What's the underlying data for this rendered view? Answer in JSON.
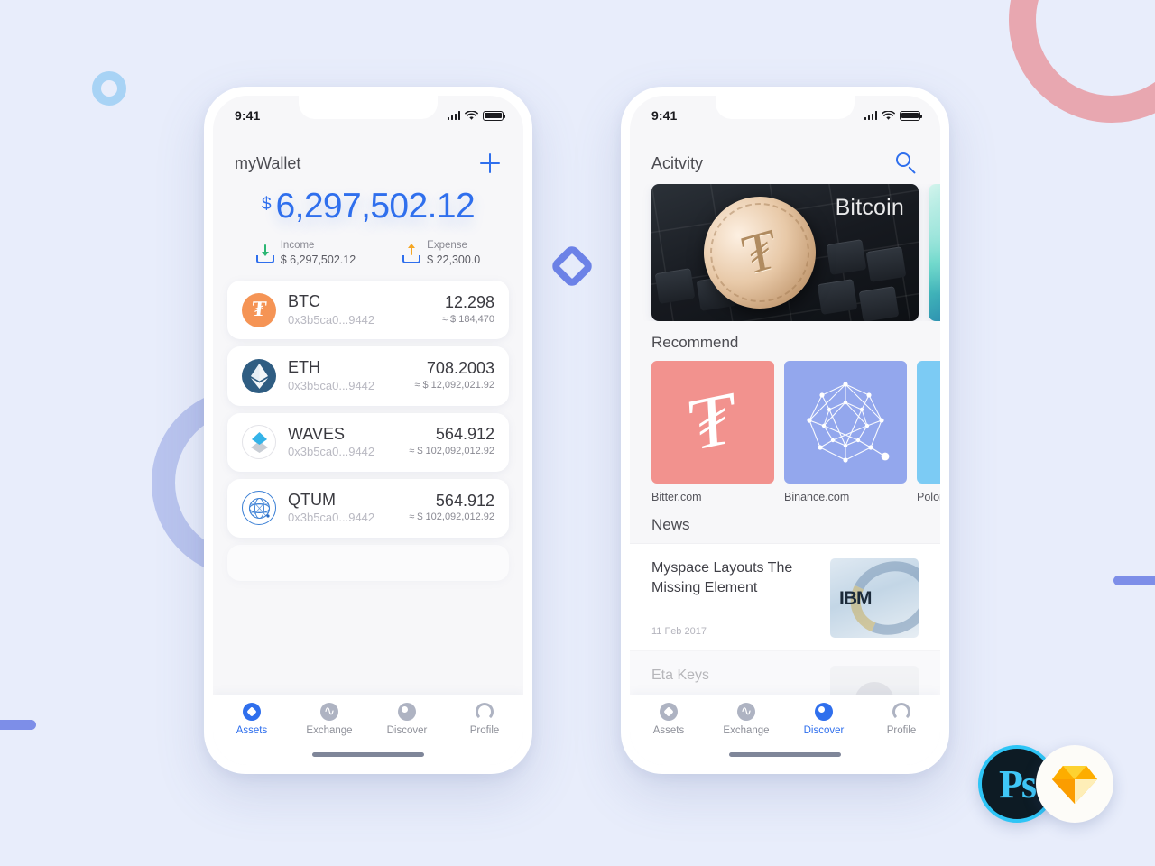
{
  "background": {
    "color": "#e8edfb",
    "decorations": [
      {
        "name": "ring-pink",
        "color": "#e8a7b0"
      },
      {
        "name": "ring-periwinkle",
        "color": "#b9c4ee"
      },
      {
        "name": "ring-lightblue",
        "color": "#a8d3f5"
      },
      {
        "name": "diamond-outline",
        "color": "#6d83e8"
      },
      {
        "name": "bar-left",
        "color": "#7d8ee8"
      },
      {
        "name": "bar-right",
        "color": "#7d8ee8"
      }
    ]
  },
  "accent_color": "#2f6fed",
  "wallet_screen": {
    "statusbar": {
      "time": "9:41",
      "icons": [
        "signal-icon",
        "wifi-icon",
        "battery-icon"
      ]
    },
    "header": {
      "title": "myWallet",
      "action_icon": "plus-icon"
    },
    "balance": {
      "currency": "$",
      "amount": "6,297,502.12"
    },
    "summary": [
      {
        "icon": "income-icon",
        "label": "Income",
        "value": "$ 6,297,502.12",
        "arrow_color": "#2bb673"
      },
      {
        "icon": "expense-icon",
        "label": "Expense",
        "value": "$ 22,300.0",
        "arrow_color": "#f5a623"
      }
    ],
    "coins": [
      {
        "icon": "btc-icon",
        "symbol": "BTC",
        "address": "0x3b5ca0...9442",
        "amount": "12.298",
        "usd": "≈ $ 184,470"
      },
      {
        "icon": "eth-icon",
        "symbol": "ETH",
        "address": "0x3b5ca0...9442",
        "amount": "708.2003",
        "usd": "≈ $ 12,092,021.92"
      },
      {
        "icon": "waves-icon",
        "symbol": "WAVES",
        "address": "0x3b5ca0...9442",
        "amount": "564.912",
        "usd": "≈ $ 102,092,012.92"
      },
      {
        "icon": "qtum-icon",
        "symbol": "QTUM",
        "address": "0x3b5ca0...9442",
        "amount": "564.912",
        "usd": "≈ $ 102,092,012.92"
      }
    ],
    "tabs": [
      {
        "icon": "assets-icon",
        "label": "Assets",
        "active": true
      },
      {
        "icon": "exchange-icon",
        "label": "Exchange",
        "active": false
      },
      {
        "icon": "discover-icon",
        "label": "Discover",
        "active": false
      },
      {
        "icon": "profile-icon",
        "label": "Profile",
        "active": false
      }
    ]
  },
  "discover_screen": {
    "statusbar": {
      "time": "9:41",
      "icons": [
        "signal-icon",
        "wifi-icon",
        "battery-icon"
      ]
    },
    "header": {
      "title": "Acitvity",
      "action_icon": "search-icon"
    },
    "banners": [
      {
        "caption": "Bitcoin",
        "art": "bitcoin-coin-on-keyboard"
      },
      {
        "caption": "",
        "art": "aurora-abstract"
      }
    ],
    "recommend": {
      "heading": "Recommend",
      "items": [
        {
          "label": "Bitter.com",
          "color": "#f2928e",
          "icon": "bitcoin-glyph"
        },
        {
          "label": "Binance.com",
          "color": "#93a7ed",
          "icon": "network-sphere-icon"
        },
        {
          "label": "Polonie",
          "color": "#7ccbf4",
          "icon": "diamond-glyph"
        }
      ]
    },
    "news": {
      "heading": "News",
      "items": [
        {
          "title": "Myspace Layouts The Missing Element",
          "date": "11 Feb 2017",
          "thumb": "ibm-server-photo"
        },
        {
          "title": "Eta Keys",
          "date": "",
          "thumb": "avatar-photo"
        }
      ]
    },
    "tabs": [
      {
        "icon": "assets-icon",
        "label": "Assets",
        "active": false
      },
      {
        "icon": "exchange-icon",
        "label": "Exchange",
        "active": false
      },
      {
        "icon": "discover-icon",
        "label": "Discover",
        "active": true
      },
      {
        "icon": "profile-icon",
        "label": "Profile",
        "active": false
      }
    ]
  },
  "logos": [
    {
      "name": "photoshop-logo",
      "text": "Ps"
    },
    {
      "name": "sketch-logo",
      "text": ""
    }
  ]
}
